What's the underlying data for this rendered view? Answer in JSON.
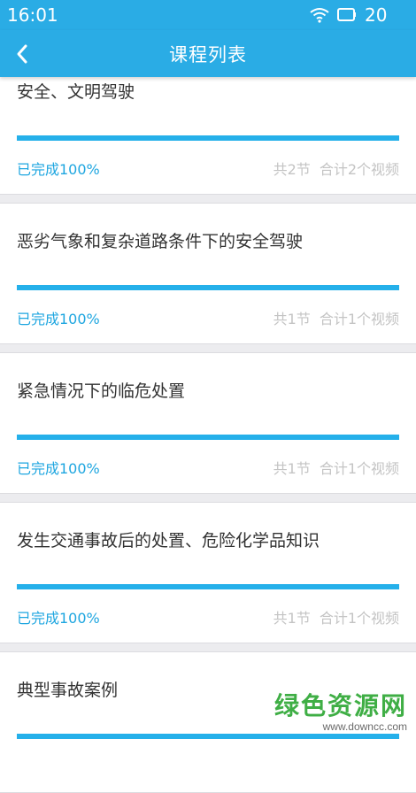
{
  "status_bar": {
    "time": "16:01",
    "battery_level": "20"
  },
  "header": {
    "title": "课程列表"
  },
  "courses": [
    {
      "title": "安全、文明驾驶",
      "progress": 100,
      "done_label": "已完成100%",
      "sections": "共2节",
      "videos": "合计2个视频"
    },
    {
      "title": "恶劣气象和复杂道路条件下的安全驾驶",
      "progress": 100,
      "done_label": "已完成100%",
      "sections": "共1节",
      "videos": "合计1个视频"
    },
    {
      "title": "紧急情况下的临危处置",
      "progress": 100,
      "done_label": "已完成100%",
      "sections": "共1节",
      "videos": "合计1个视频"
    },
    {
      "title": "发生交通事故后的处置、危险化学品知识",
      "progress": 100,
      "done_label": "已完成100%",
      "sections": "共1节",
      "videos": "合计1个视频"
    },
    {
      "title": "典型事故案例",
      "progress": 100,
      "done_label": "",
      "sections": "",
      "videos": ""
    }
  ],
  "watermark": {
    "name": "绿色资源网",
    "url": "www.downcc.com"
  },
  "colors": {
    "accent": "#2aace5",
    "progress": "#25b0ea",
    "done_text": "#1ea6e0",
    "meta_text": "#c4c4c4"
  }
}
